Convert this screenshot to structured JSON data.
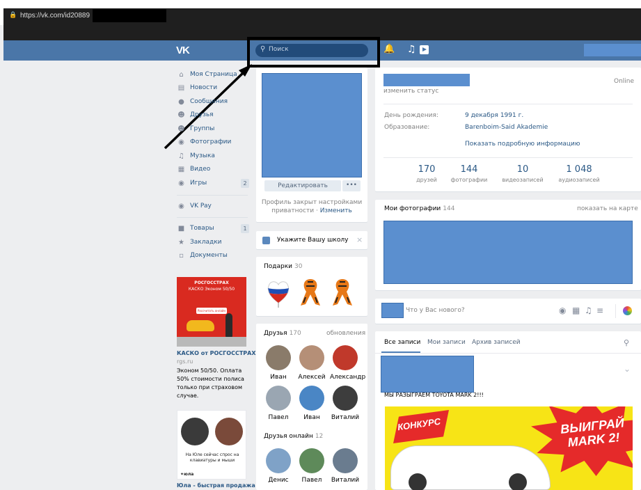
{
  "browser": {
    "url": "https://vk.com/id20889"
  },
  "header": {
    "logo": "VK",
    "search_placeholder": "Поиск"
  },
  "nav": {
    "items": [
      {
        "label": "Моя Страница",
        "icon": "home-icon"
      },
      {
        "label": "Новости",
        "icon": "news-icon"
      },
      {
        "label": "Сообщения",
        "icon": "messages-icon"
      },
      {
        "label": "Друзья",
        "icon": "friends-icon"
      },
      {
        "label": "Группы",
        "icon": "groups-icon"
      },
      {
        "label": "Фотографии",
        "icon": "camera-icon"
      },
      {
        "label": "Музыка",
        "icon": "music-icon"
      },
      {
        "label": "Видео",
        "icon": "video-icon"
      },
      {
        "label": "Игры",
        "icon": "games-icon",
        "badge": "2"
      },
      {
        "label": "VK Pay",
        "icon": "vkpay-icon"
      },
      {
        "label": "Товары",
        "icon": "bag-icon",
        "badge": "1"
      },
      {
        "label": "Закладки",
        "icon": "star-icon"
      },
      {
        "label": "Документы",
        "icon": "document-icon"
      }
    ]
  },
  "ads": [
    {
      "image_brand": "РОСГОССТРАХ",
      "image_line": "КАСКО Эконом 50/50",
      "image_button": "Рассчитать онлайн",
      "title": "КАСКО от РОСГОССТРАХ",
      "domain": "rgs.ru",
      "text": "Эконом 50/50. Оплата 50% стоимости полиса только при страховом случае."
    },
    {
      "image_caption": "На Юле сейчас спрос на клавиатуры и мыши",
      "image_logo": "✦юла",
      "title": "Юла - быстрая продажа"
    }
  ],
  "profile": {
    "edit_label": "Редактировать",
    "more_label": "•••",
    "closed_text": "Профиль закрыт настройками приватности",
    "closed_link": "Изменить",
    "status_link": "изменить статус",
    "online": "Online",
    "birthday_label": "День рождения:",
    "birthday_value": "9 декабря 1991 г.",
    "education_label": "Образование:",
    "education_value": "Barenboim-Said Akademie",
    "more_info": "Показать подробную информацию",
    "stats": [
      {
        "num": "170",
        "label": "друзей"
      },
      {
        "num": "144",
        "label": "фотографии"
      },
      {
        "num": "10",
        "label": "видеозаписей"
      },
      {
        "num": "1 048",
        "label": "аудиозаписей"
      }
    ]
  },
  "school": {
    "text": "Укажите Вашу школу",
    "close": "×"
  },
  "gifts": {
    "title": "Подарки",
    "count": "30"
  },
  "friends": {
    "title": "Друзья",
    "count": "170",
    "updates_link": "обновления",
    "list": [
      {
        "name": "Иван",
        "color": "#8a7b6a"
      },
      {
        "name": "Алексей",
        "color": "#b58f77"
      },
      {
        "name": "Александр",
        "color": "#c0392b"
      },
      {
        "name": "Павел",
        "color": "#9aa6b2"
      },
      {
        "name": "Иван",
        "color": "#4a86c5"
      },
      {
        "name": "Виталий",
        "color": "#3d3d3d"
      }
    ],
    "online_title": "Друзья онлайн",
    "online_count": "12",
    "online_list": [
      {
        "name": "Денис",
        "color": "#7fa2c7"
      },
      {
        "name": "Павел",
        "color": "#5e8a5a"
      },
      {
        "name": "Виталий",
        "color": "#6a7c8f"
      }
    ]
  },
  "photos": {
    "title": "Мои фотографии",
    "count": "144",
    "map_link": "показать на карте"
  },
  "new_post": {
    "placeholder": "Что у Вас нового?"
  },
  "wall": {
    "tabs": [
      "Все записи",
      "Мои записи",
      "Архив записей"
    ],
    "post_text": "МЫ РАЗЫГРАЕМ TOYOTA MARK 2!!!",
    "post_image_left": "КОНКУРС",
    "post_image_right": "ВЫИГРАЙ MARK 2!"
  }
}
